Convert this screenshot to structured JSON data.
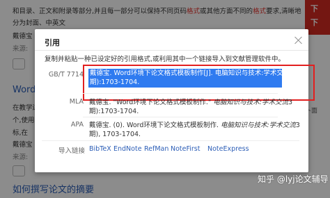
{
  "background": {
    "line1_pre": "和目录、正文和附录等部分,并且每一部分可以保持不同页码",
    "line1_red1": "格式",
    "line1_mid": "或其他方面不同的",
    "line1_red2": "格式",
    "line1_post": "要求,清晰地",
    "line2": "分为封面、中英文",
    "author1": "戴德宝",
    "source1": "来源:",
    "word_title": "Word",
    "line3": "在教学过",
    "line4": "个,使用",
    "line5": "标,在",
    "author2": "戴德宝",
    "source2": "来源:",
    "bottom_link": "如何撰写论文的摘要",
    "side_text": "卜面"
  },
  "dialog": {
    "title": "引用",
    "description": "复制并粘贴一种已设定好的引用格式,或利用其中一个链接导入到文献管理软件中。",
    "rows": [
      {
        "label": "GB/T 7714",
        "line1": "戴德宝. Word环境下论文格式模板制作[J]. 电脑知识与技术:学术交流(3",
        "line2": "期):1703-1704."
      },
      {
        "label": "MLA",
        "line1_plain": "戴德宝. \"Word环境下论文格式模板制作.\" ",
        "line1_italic": "电脑知识与技术:学术交流",
        "line1_post": "3",
        "line2": "期):1703-1704."
      },
      {
        "label": "APA",
        "line1_plain": "戴德宝. (0). Word环境下论文格式模板制作. ",
        "line1_italic": "电脑知识与技术:学术交流",
        "line1_post": "3",
        "line2": "期), 1703-1704."
      }
    ],
    "export_label": "导入链接",
    "export_links": [
      "BibTeX",
      "EndNote",
      "RefMan",
      "NoteFirst",
      "NoteExpress"
    ]
  },
  "watermark": "知乎 @lyj论文辅导"
}
